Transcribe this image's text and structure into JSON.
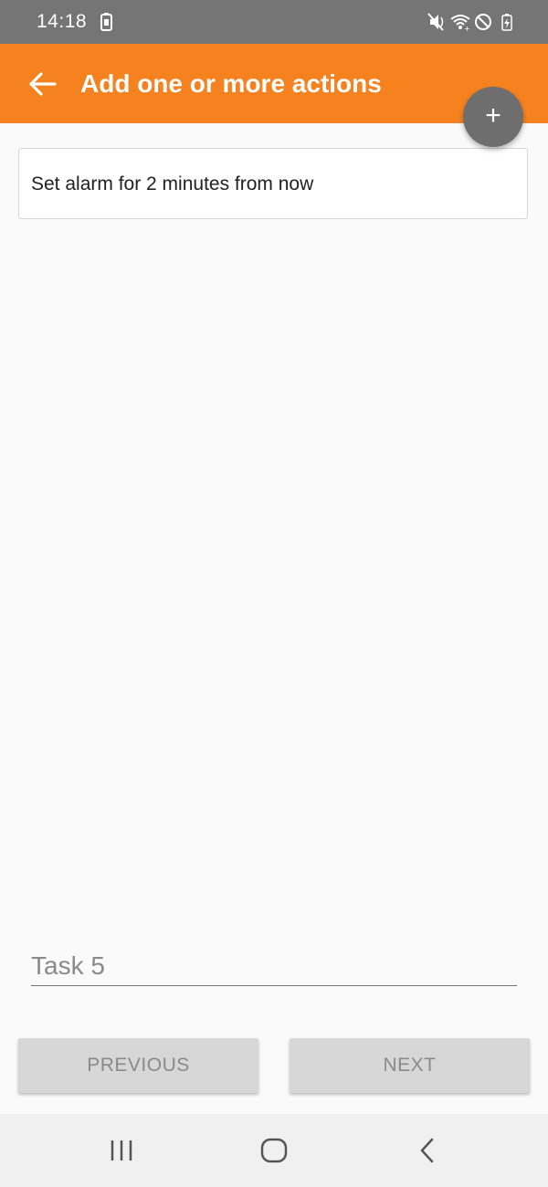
{
  "status_bar": {
    "time": "14:18",
    "icons": [
      "screenshot-icon",
      "vibrate-icon",
      "wifi-icon",
      "do-not-disturb-icon",
      "battery-icon"
    ]
  },
  "app_bar": {
    "title": "Add one or more actions",
    "back_icon": "arrow-back-icon",
    "color": "#f5821f"
  },
  "fab": {
    "icon": "+",
    "color": "#6e6e6e"
  },
  "actions": [
    {
      "label": "Set alarm for 2 minutes from now"
    }
  ],
  "task_input": {
    "value": "",
    "placeholder": "Task 5"
  },
  "buttons": {
    "previous": "PREVIOUS",
    "next": "NEXT"
  },
  "system_nav": {
    "items": [
      "recent-apps-icon",
      "home-icon",
      "back-icon"
    ]
  }
}
